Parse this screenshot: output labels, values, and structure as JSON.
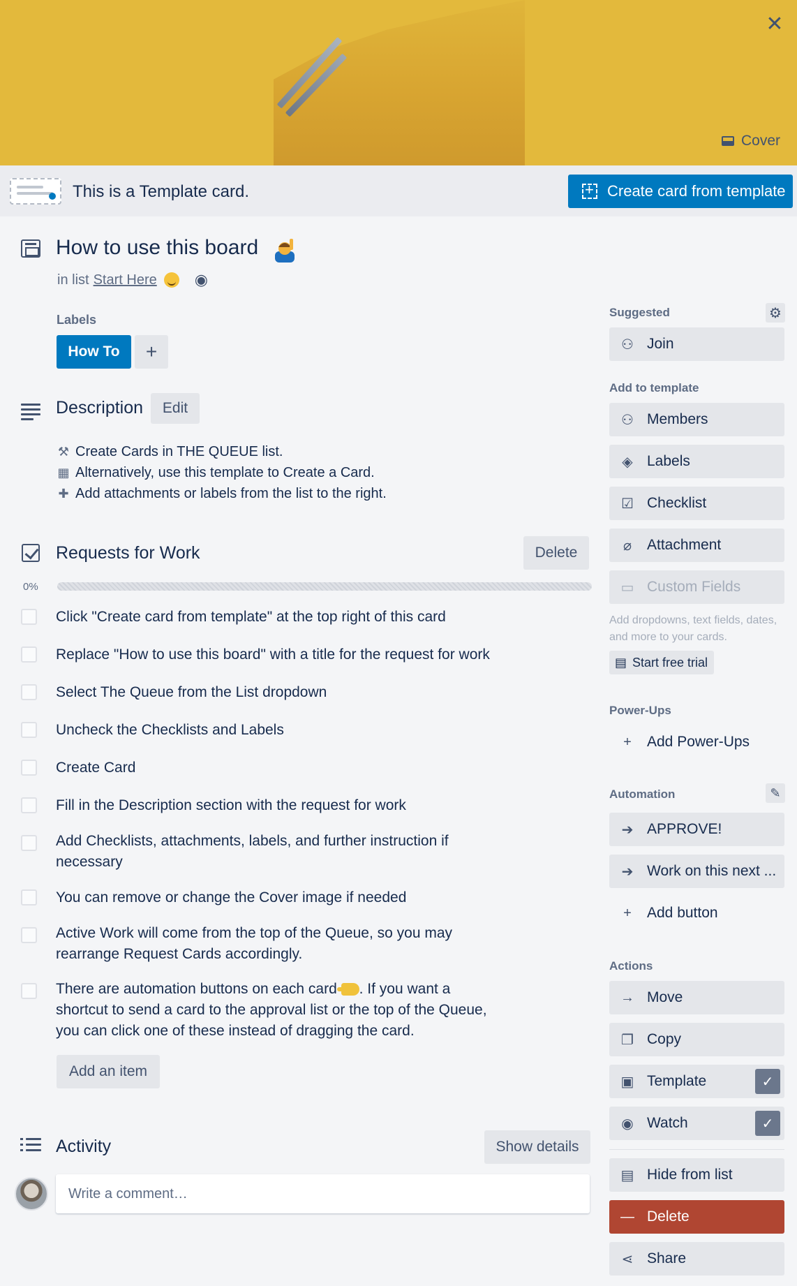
{
  "cover": {
    "button_label": "Cover",
    "close_icon": "close-icon",
    "color": "#e3b93c"
  },
  "banner": {
    "text": "This is a Template card.",
    "create_button": "Create card from template"
  },
  "card": {
    "title": "How to use this board",
    "in_list_prefix": "in list",
    "list_name": "Start Here"
  },
  "labels": {
    "heading": "Labels",
    "items": [
      {
        "name": "How To",
        "color": "#0079bf"
      }
    ],
    "add_symbol": "+"
  },
  "description": {
    "heading": "Description",
    "edit_label": "Edit",
    "lines": [
      {
        "icon": "⚒",
        "text": "Create Cards in THE QUEUE list."
      },
      {
        "icon": "▦",
        "text": "Alternatively, use this template to Create a Card."
      },
      {
        "icon": "✚",
        "text": "Add attachments or labels from the list to the right."
      }
    ]
  },
  "checklist": {
    "heading": "Requests for Work",
    "delete_label": "Delete",
    "progress_label": "0%",
    "progress": 0,
    "items": [
      "Click \"Create card from template\" at the top right of this card",
      "Replace \"How to use this board\" with a title for the request for work",
      "Select The Queue from the List dropdown",
      "Uncheck the Checklists and Labels",
      "Create Card",
      "Fill in the Description section with the request for work",
      "Add Checklists, attachments, labels, and further instruction if necessary",
      "You can remove or change the Cover image if needed",
      "Active Work will come from the top of the Queue, so you may rearrange Request Cards accordingly.",
      "There are automation buttons on each card",
      "If you want a shortcut to send a card to the approval list or the top of the Queue, you can click one of these instead of dragging the card."
    ],
    "add_item_label": "Add an item"
  },
  "activity": {
    "heading": "Activity",
    "show_details_label": "Show details",
    "comment_placeholder": "Write a comment…"
  },
  "sidebar": {
    "suggested_heading": "Suggested",
    "join_label": "Join",
    "add_to_template_heading": "Add to template",
    "add_items": [
      "Members",
      "Labels",
      "Checklist",
      "Attachment",
      "Custom Fields"
    ],
    "custom_fields_note": "Add dropdowns, text fields, dates, and more to your cards.",
    "trial_label": "Start free trial",
    "powerups_heading": "Power-Ups",
    "add_powerups_label": "Add Power-Ups",
    "automation_heading": "Automation",
    "automation_buttons": [
      "APPROVE!",
      "Work on this next ..."
    ],
    "add_button_label": "Add button",
    "actions_heading": "Actions",
    "actions": [
      "Move",
      "Copy",
      "Template",
      "Watch",
      "Hide from list",
      "Delete",
      "Share"
    ],
    "tick": "✓",
    "danger_color": "#b04632",
    "accent_color": "#0079bf"
  }
}
